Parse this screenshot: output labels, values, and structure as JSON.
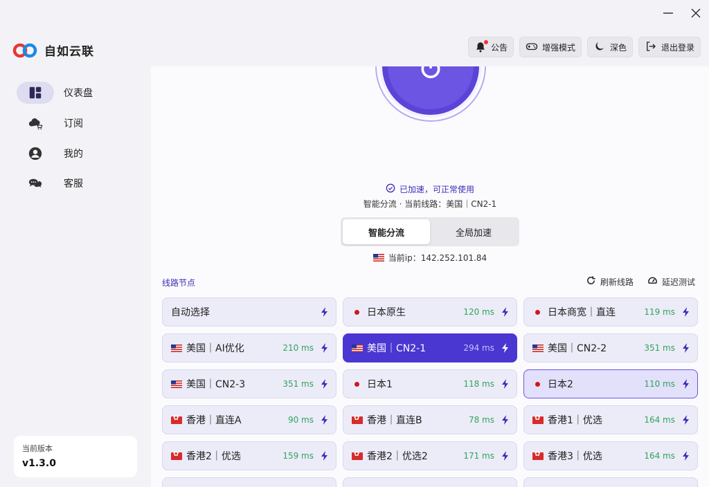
{
  "app": {
    "name": "自如云联"
  },
  "window": {
    "minimize_icon": "minimize-icon",
    "close_icon": "close-icon"
  },
  "toolbar": {
    "announce_label": "公告",
    "enhanced_label": "增强模式",
    "dark_label": "深色",
    "logout_label": "退出登录"
  },
  "sidebar": {
    "items": [
      {
        "label": "仪表盘",
        "icon": "dashboard-icon",
        "active": true
      },
      {
        "label": "订阅",
        "icon": "cloud-cart-icon",
        "active": false
      },
      {
        "label": "我的",
        "icon": "user-icon",
        "active": false
      },
      {
        "label": "客服",
        "icon": "chat-icon",
        "active": false
      }
    ],
    "version_label": "当前版本",
    "version_value": "v1.3.0"
  },
  "main": {
    "status_text": "已加速，可正常使用",
    "route_text": "智能分流 · 当前线路：美国｜CN2-1",
    "mode_smart": "智能分流",
    "mode_global": "全局加速",
    "ip_text": "当前ip：142.252.101.84",
    "section_title": "线路节点",
    "refresh_label": "刷新线路",
    "latency_test_label": "延迟测试"
  },
  "nodes": [
    {
      "name": "自动选择",
      "flag": "none",
      "latency": ""
    },
    {
      "name": "日本原生",
      "flag": "jp",
      "latency": "120 ms"
    },
    {
      "name": "日本商宽｜直连",
      "flag": "jp",
      "latency": "119 ms"
    },
    {
      "name": "美国｜AI优化",
      "flag": "us",
      "latency": "210 ms"
    },
    {
      "name": "美国｜CN2-1",
      "flag": "us",
      "latency": "294 ms",
      "selected": true
    },
    {
      "name": "美国｜CN2-2",
      "flag": "us",
      "latency": "351 ms"
    },
    {
      "name": "美国｜CN2-3",
      "flag": "us",
      "latency": "351 ms"
    },
    {
      "name": "日本1",
      "flag": "jp",
      "latency": "118 ms"
    },
    {
      "name": "日本2",
      "flag": "jp",
      "latency": "110 ms",
      "hover": true
    },
    {
      "name": "香港｜直连A",
      "flag": "hk",
      "latency": "90 ms"
    },
    {
      "name": "香港｜直连B",
      "flag": "hk",
      "latency": "78 ms"
    },
    {
      "name": "香港1｜优选",
      "flag": "hk",
      "latency": "164 ms"
    },
    {
      "name": "香港2｜优选",
      "flag": "hk",
      "latency": "159 ms"
    },
    {
      "name": "香港2｜优选2",
      "flag": "hk",
      "latency": "171 ms"
    },
    {
      "name": "香港3｜优选",
      "flag": "hk",
      "latency": "164 ms"
    },
    {
      "name": "",
      "flag": "hk",
      "latency": ""
    },
    {
      "name": "",
      "flag": "hk",
      "latency": ""
    },
    {
      "name": "",
      "flag": "hk",
      "latency": ""
    }
  ],
  "colors": {
    "accent": "#4a36d1",
    "latency": "#2fa55a",
    "status": "#3d2fb8"
  }
}
